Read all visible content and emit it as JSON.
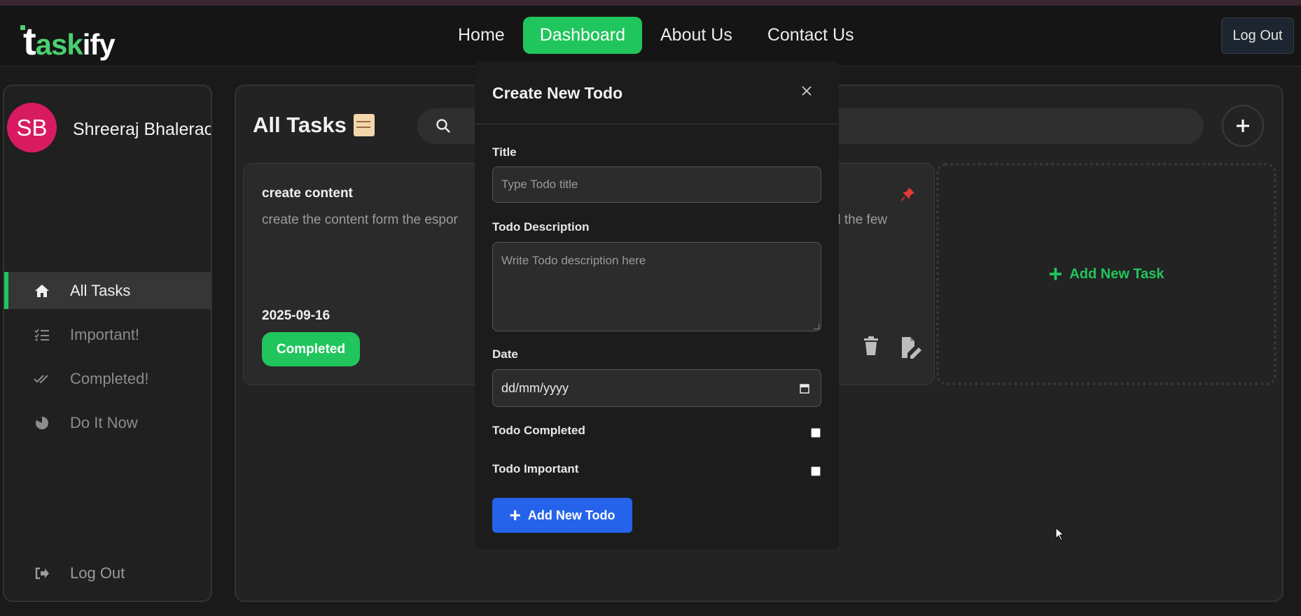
{
  "app": {
    "logo_t": "t",
    "logo_ask": "ask",
    "logo_ify": "ify"
  },
  "navbar": {
    "links": [
      {
        "label": "Home"
      },
      {
        "label": "Dashboard",
        "active": true
      },
      {
        "label": "About Us"
      },
      {
        "label": "Contact Us"
      }
    ],
    "logout_label": "Log Out"
  },
  "sidebar": {
    "avatar_initials": "SB",
    "username": "Shreeraj Bhalerao",
    "items": [
      {
        "label": "All Tasks",
        "icon": "home-icon",
        "active": true
      },
      {
        "label": "Important!",
        "icon": "list-check-icon"
      },
      {
        "label": "Completed!",
        "icon": "double-check-icon"
      },
      {
        "label": "Do It Now",
        "icon": "pie-icon"
      }
    ],
    "logout_label": "Log Out"
  },
  "main": {
    "title": "All Tasks",
    "title_emoji": "scroll-icon",
    "card": {
      "title": "create content",
      "description": "create the content form the espor",
      "description_tail": "and the few",
      "date": "2025-09-16",
      "status": "Completed"
    },
    "add_task_label": "Add New Task"
  },
  "modal": {
    "title": "Create New Todo",
    "title_label": "Title",
    "title_placeholder": "Type Todo title",
    "description_label": "Todo Description",
    "description_placeholder": "Write Todo description here",
    "date_label": "Date",
    "date_placeholder": "dd/mm/yyyy",
    "completed_label": "Todo Completed",
    "important_label": "Todo Important",
    "submit_label": "Add New Todo"
  },
  "colors": {
    "accent": "#21c55d",
    "primary_button": "#2563eb",
    "avatar": "#d81b60",
    "pin": "#e53935"
  }
}
